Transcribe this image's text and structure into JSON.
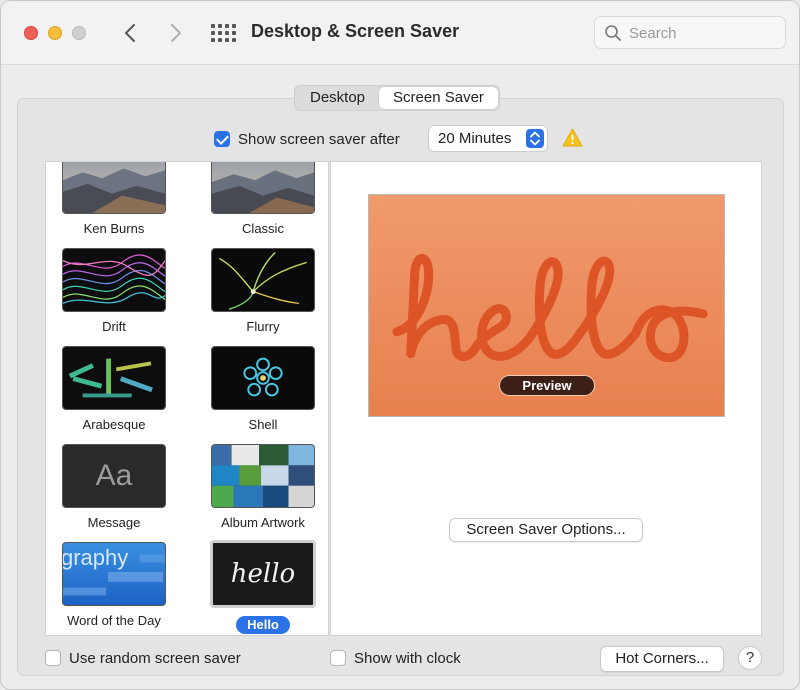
{
  "window": {
    "title": "Desktop & Screen Saver"
  },
  "search": {
    "placeholder": "Search"
  },
  "tabs": [
    {
      "label": "Desktop",
      "active": false
    },
    {
      "label": "Screen Saver",
      "active": true
    }
  ],
  "show_after": {
    "label": "Show screen saver after",
    "checked": true,
    "value": "20 Minutes"
  },
  "modules": [
    {
      "label": "Ken Burns"
    },
    {
      "label": "Classic"
    },
    {
      "label": "Drift"
    },
    {
      "label": "Flurry"
    },
    {
      "label": "Arabesque"
    },
    {
      "label": "Shell"
    },
    {
      "label": "Message",
      "thumb_text": "Aa"
    },
    {
      "label": "Album Artwork"
    },
    {
      "label": "Word of the Day",
      "thumb_text": "graphy"
    },
    {
      "label": "Hello",
      "thumb_text": "hello",
      "selected": true
    }
  ],
  "preview": {
    "text": "hello",
    "button_label": "Preview",
    "background": "#ec8a5c",
    "text_color": "#de5a28"
  },
  "options_button": "Screen Saver Options...",
  "bottom": {
    "random_label": "Use random screen saver",
    "random_checked": false,
    "clock_label": "Show with clock",
    "clock_checked": false,
    "hot_corners_label": "Hot Corners...",
    "help_label": "?"
  },
  "colors": {
    "accent": "#2a72e5",
    "warning": "#f4c21b"
  }
}
